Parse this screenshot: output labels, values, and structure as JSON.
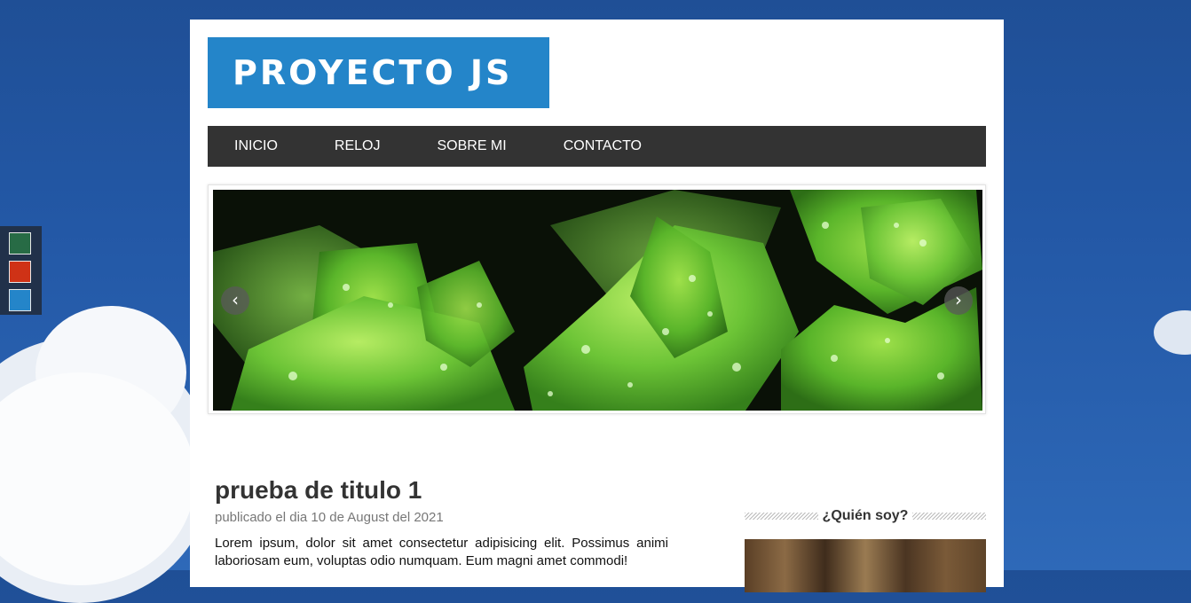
{
  "site": {
    "logo": "PROYECTO JS"
  },
  "nav": {
    "items": [
      "INICIO",
      "RELOJ",
      "SOBRE MI",
      "CONTACTO"
    ]
  },
  "theme_switcher": {
    "colors": [
      "#276b45",
      "#cf3216",
      "#2485c9"
    ]
  },
  "slider": {
    "prev_icon": "chevron-left-icon",
    "next_icon": "chevron-right-icon",
    "prev_glyph": "‹",
    "next_glyph": "›"
  },
  "post": {
    "title": "prueba de titulo 1",
    "meta": "publicado el dia 10 de August del 2021",
    "body": "Lorem ipsum, dolor sit amet consectetur adipisicing elit. Possimus animi laboriosam eum, voluptas odio numquam. Eum magni amet commodi!"
  },
  "sidebar": {
    "heading": "¿Quién soy?"
  },
  "colors": {
    "accent": "#2485c9",
    "nav_bg": "#333333"
  }
}
